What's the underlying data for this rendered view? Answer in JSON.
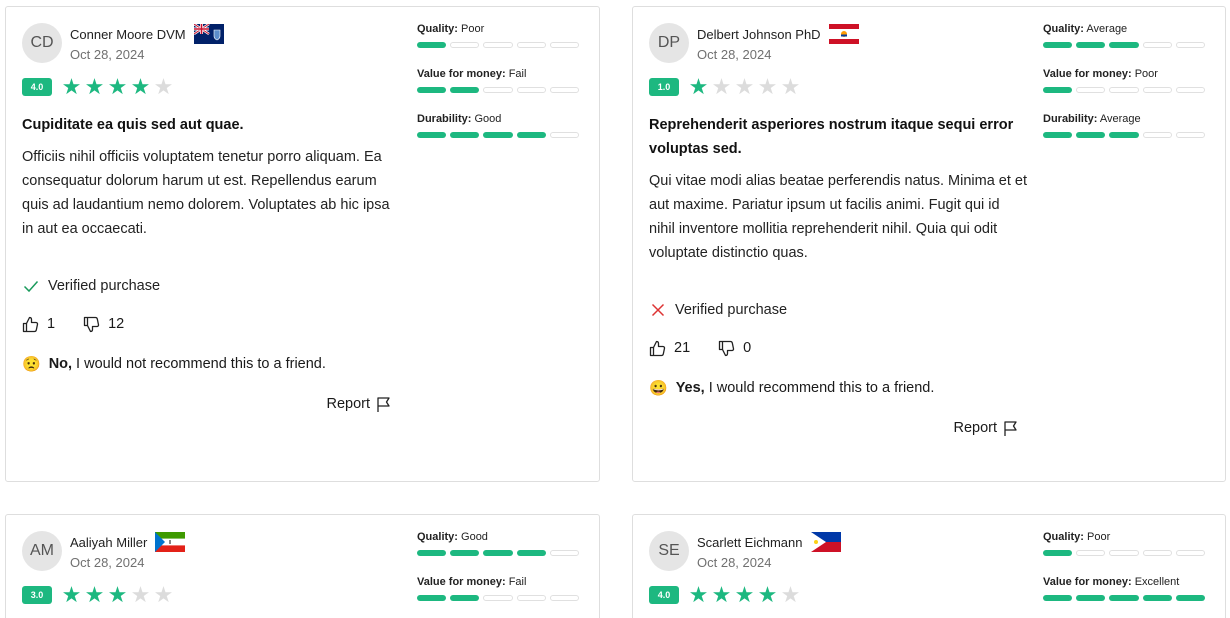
{
  "colors": {
    "accent": "#1db880",
    "off": "#dcdcdc"
  },
  "reviews": [
    {
      "initials": "CD",
      "name": "Conner Moore DVM",
      "flag": "falkland-islands-flag",
      "date": "Oct 28, 2024",
      "rating_label": "4.0",
      "rating": 4,
      "title": "Cupiditate ea quis sed aut quae.",
      "body": "Officiis nihil officiis voluptatem tenetur porro aliquam. Ea consequatur dolorum harum ut est. Repellendus earum quis ad laudantium nemo dolorem. Voluptates ab hic ipsa in aut ea occaecati.",
      "verified": true,
      "verified_label": "Verified purchase",
      "upvotes": "1",
      "downvotes": "12",
      "recommend_icon": "sad-face-emoji",
      "recommend_answer": "No,",
      "recommend_text": "I would not recommend this to a friend.",
      "report_label": "Report",
      "metrics": [
        {
          "label": "Quality:",
          "value": "Poor",
          "level": 1
        },
        {
          "label": "Value for money:",
          "value": "Fail",
          "level": 2
        },
        {
          "label": "Durability:",
          "value": "Good",
          "level": 4
        }
      ]
    },
    {
      "initials": "DP",
      "name": "Delbert Johnson PhD",
      "flag": "french-polynesia-flag",
      "date": "Oct 28, 2024",
      "rating_label": "1.0",
      "rating": 1,
      "title": "Reprehenderit asperiores nostrum itaque sequi error voluptas sed.",
      "body": "Qui vitae modi alias beatae perferendis natus. Minima et et aut maxime. Pariatur ipsum ut facilis animi. Fugit qui id nihil inventore mollitia reprehenderit nihil. Quia qui odit voluptate distinctio quas.",
      "verified": false,
      "verified_label": "Verified purchase",
      "upvotes": "21",
      "downvotes": "0",
      "recommend_icon": "happy-face-emoji",
      "recommend_answer": "Yes,",
      "recommend_text": "I would recommend this to a friend.",
      "report_label": "Report",
      "metrics": [
        {
          "label": "Quality:",
          "value": "Average",
          "level": 3
        },
        {
          "label": "Value for money:",
          "value": "Poor",
          "level": 1
        },
        {
          "label": "Durability:",
          "value": "Average",
          "level": 3
        }
      ]
    },
    {
      "initials": "AM",
      "name": "Aaliyah Miller",
      "flag": "equatorial-guinea-flag",
      "date": "Oct 28, 2024",
      "rating_label": "3.0",
      "rating": 3,
      "metrics": [
        {
          "label": "Quality:",
          "value": "Good",
          "level": 4
        },
        {
          "label": "Value for money:",
          "value": "Fail",
          "level": 2
        }
      ]
    },
    {
      "initials": "SE",
      "name": "Scarlett Eichmann",
      "flag": "philippines-flag",
      "date": "Oct 28, 2024",
      "rating_label": "4.0",
      "rating": 4,
      "metrics": [
        {
          "label": "Quality:",
          "value": "Poor",
          "level": 1
        },
        {
          "label": "Value for money:",
          "value": "Excellent",
          "level": 5
        }
      ]
    }
  ]
}
